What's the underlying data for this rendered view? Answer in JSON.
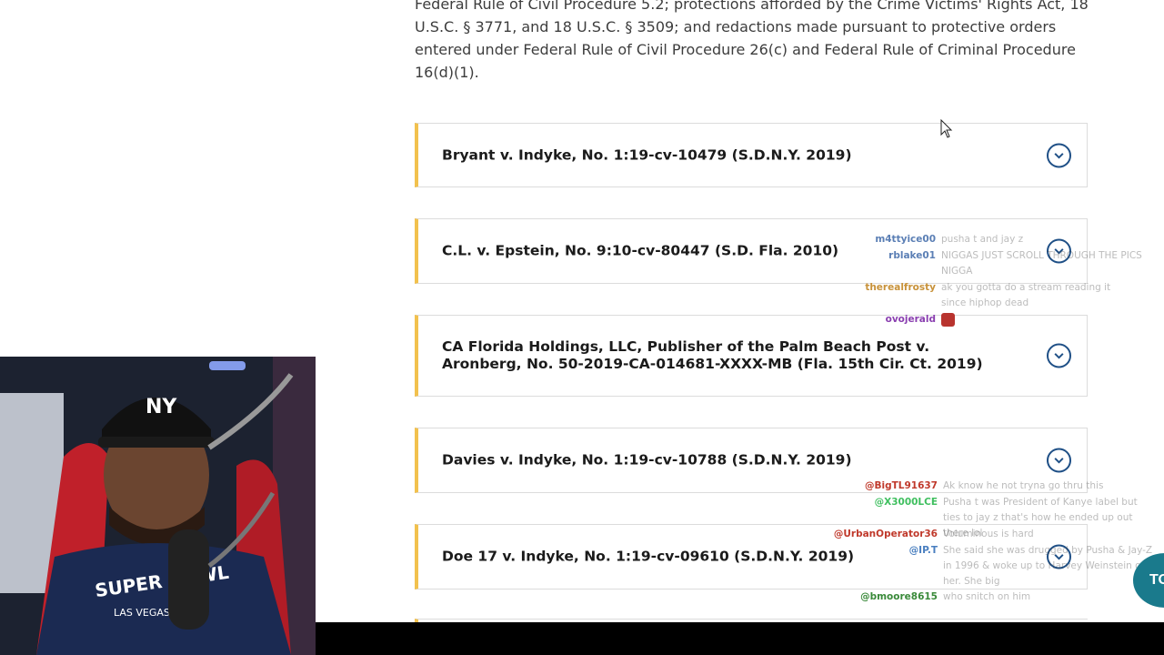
{
  "intro": {
    "text": "Federal Rule of Civil Procedure 5.2; protections afforded by the Crime Victims' Rights Act, 18 U.S.C. § 3771, and 18 U.S.C. § 3509; and redactions made pursuant to protective orders entered under Federal Rule of Civil Procedure 26(c) and Federal Rule of Criminal Procedure 16(d)(1)."
  },
  "cases": [
    {
      "title": "Bryant v. Indyke, No. 1:19-cv-10479 (S.D.N.Y. 2019)"
    },
    {
      "title": "C.L. v. Epstein, No. 9:10-cv-80447 (S.D. Fla. 2010)"
    },
    {
      "title": "CA Florida Holdings, LLC, Publisher of the Palm Beach Post v. Aronberg, No. 50-2019-CA-014681-XXXX-MB (Fla. 15th Cir. Ct. 2019)"
    },
    {
      "title": "Davies v. Indyke, No. 1:19-cv-10788 (S.D.N.Y. 2019)"
    },
    {
      "title": "Doe 17 v. Indyke, No. 1:19-cv-09610 (S.D.N.Y. 2019)"
    }
  ],
  "chat": [
    {
      "user": "m4ttyice00",
      "color": "#5b7fb5",
      "message": "pusha t and jay z"
    },
    {
      "user": "rblake01",
      "color": "#5b7fb5",
      "message": "NIGGAS JUST SCROLL THROUGH THE PICS NIGGA"
    },
    {
      "user": "therealfrosty",
      "color": "#c8923a",
      "message": "ak you gotta do a stream reading it since hiphop dead"
    },
    {
      "user": "ovojerald",
      "color": "#8a3fb0",
      "message": ""
    },
    {
      "user": "@BigTL91637",
      "color": "#c0392b",
      "message": "Ak know he not tryna go thru this"
    },
    {
      "user": "@X3000LCE",
      "color": "#3fbf5f",
      "message": "Pusha t was President of Kanye label but ties to jay z that's how he ended up out there lol"
    },
    {
      "user": "@UrbanOperator36",
      "color": "#c0392b",
      "message": "Voluminous is hard"
    },
    {
      "user": "@IP.T",
      "color": "#4a7fc0",
      "message": "She said she was drugged by Pusha & Jay-Z in 1996 & woke up to Harvey Weinstein on her. She big"
    },
    {
      "user": "@bmoore8615",
      "color": "#3a8a3a",
      "message": "who snitch on him"
    }
  ],
  "webcam": {
    "cap_text": "NY",
    "shirt_text": "SUPER BOWL",
    "shirt_subtext": "LAS VEGAS"
  },
  "top_button": {
    "label": "TO"
  },
  "colors": {
    "accent_bar": "#f2c14e",
    "chevron": "#1e4f86",
    "top_button": "#1a7a8c"
  },
  "icons": {
    "expand": "chevron-down-icon",
    "cursor": "mouse-pointer-icon"
  }
}
